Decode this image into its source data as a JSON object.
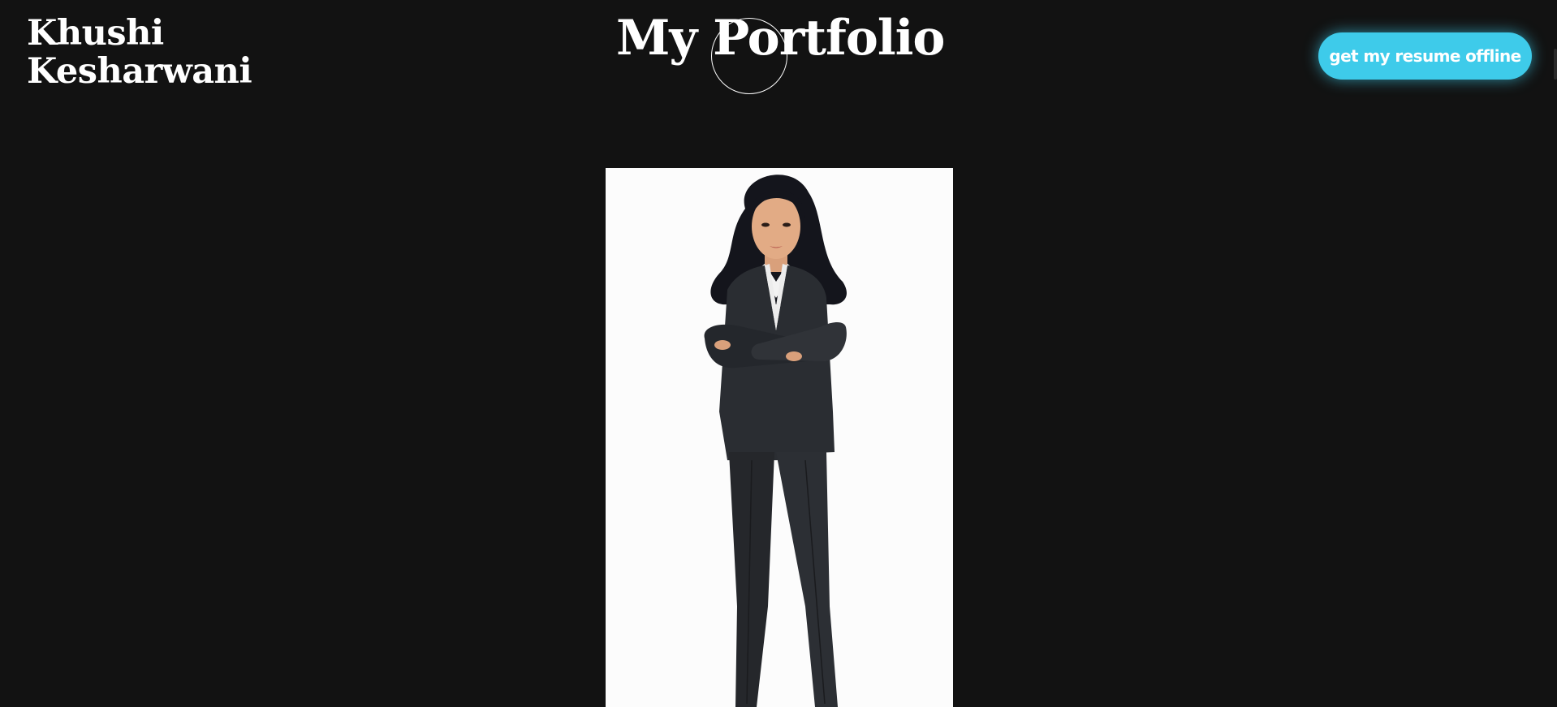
{
  "header": {
    "name_line1": "Khushi",
    "name_line2": "Kesharwani",
    "title": "My Portfolio",
    "resume_button_label": "get my resume offline"
  },
  "hero": {
    "portrait": "illustrated-woman-in-black-suit"
  },
  "colors": {
    "background": "#121212",
    "accent": "#3ecbea",
    "text": "#ffffff"
  }
}
